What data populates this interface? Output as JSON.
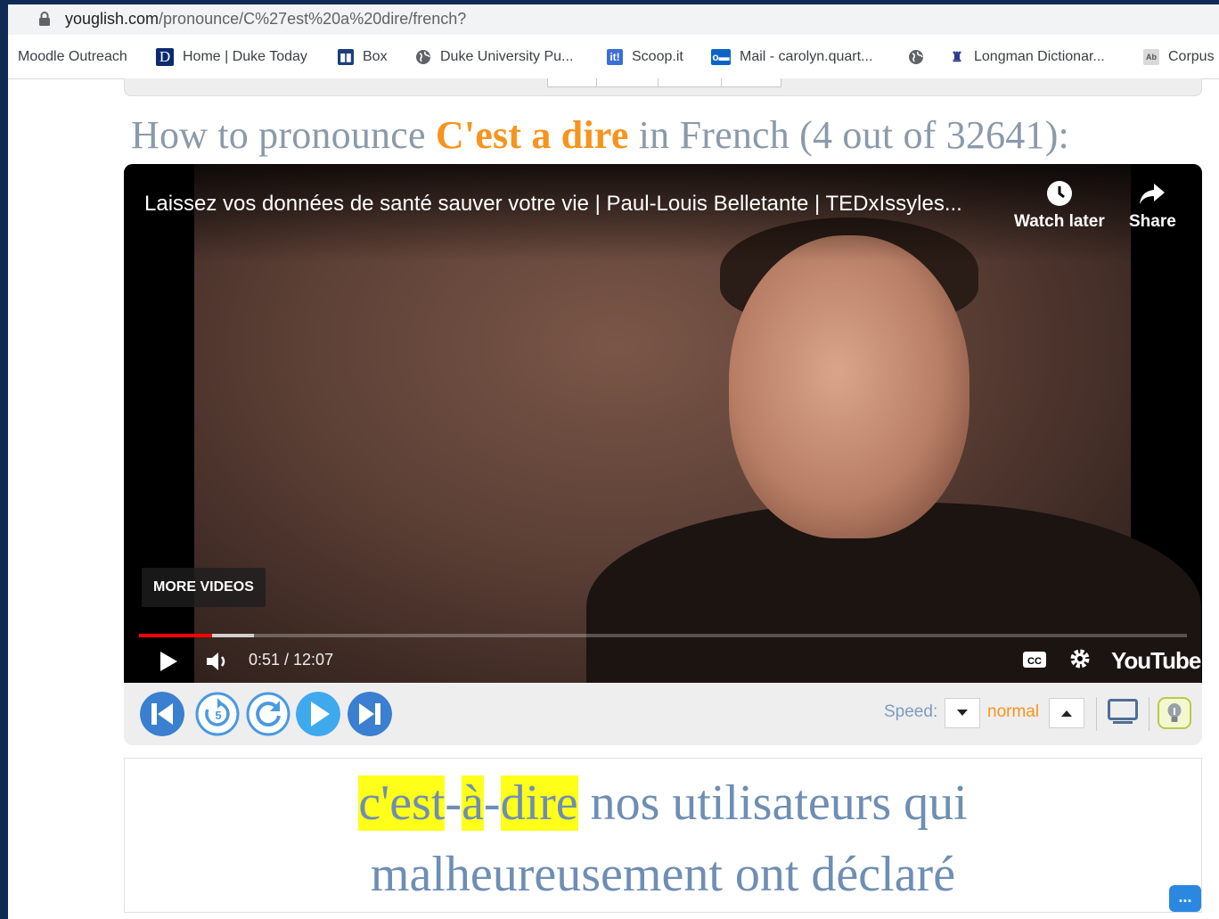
{
  "browser": {
    "url_host": "youglish.com",
    "url_path": "/pronounce/C%27est%20a%20dire/french?"
  },
  "bookmarks": [
    {
      "label": "Moodle Outreach",
      "icon": "none"
    },
    {
      "label": "Home | Duke Today",
      "icon": "duke-d-icon"
    },
    {
      "label": "Box",
      "icon": "box-icon"
    },
    {
      "label": "Duke University Pu...",
      "icon": "globe-icon"
    },
    {
      "label": "Scoop.it",
      "icon": "scoopit-icon"
    },
    {
      "label": "Mail - carolyn.quart...",
      "icon": "outlook-icon"
    },
    {
      "label": "",
      "icon": "globe-icon"
    },
    {
      "label": "Longman Dictionar...",
      "icon": "longman-icon"
    },
    {
      "label": "Corpus",
      "icon": "corpus-icon"
    }
  ],
  "heading": {
    "prefix": "How to pronounce ",
    "term": "C'est a dire",
    "suffix": " in French (4 out of 32641):"
  },
  "video": {
    "title": "Laissez vos données de santé sauver votre vie | Paul-Louis Belletante | TEDxIssyles...",
    "watch_later": "Watch later",
    "share": "Share",
    "more_videos": "MORE VIDEOS",
    "time": "0:51 / 12:07",
    "played_fraction": 0.07,
    "buffered_fraction": 0.11,
    "logo": "YouTube"
  },
  "controls": {
    "speed_label": "Speed:",
    "speed_value": "normal"
  },
  "caption": {
    "w1": "c'est",
    "d1": "-",
    "w2": "à",
    "d2": "-",
    "w3": "dire",
    "rest1": " nos utilisateurs qui",
    "rest2": "malheureusement ont déclaré"
  },
  "more_button": "..."
}
